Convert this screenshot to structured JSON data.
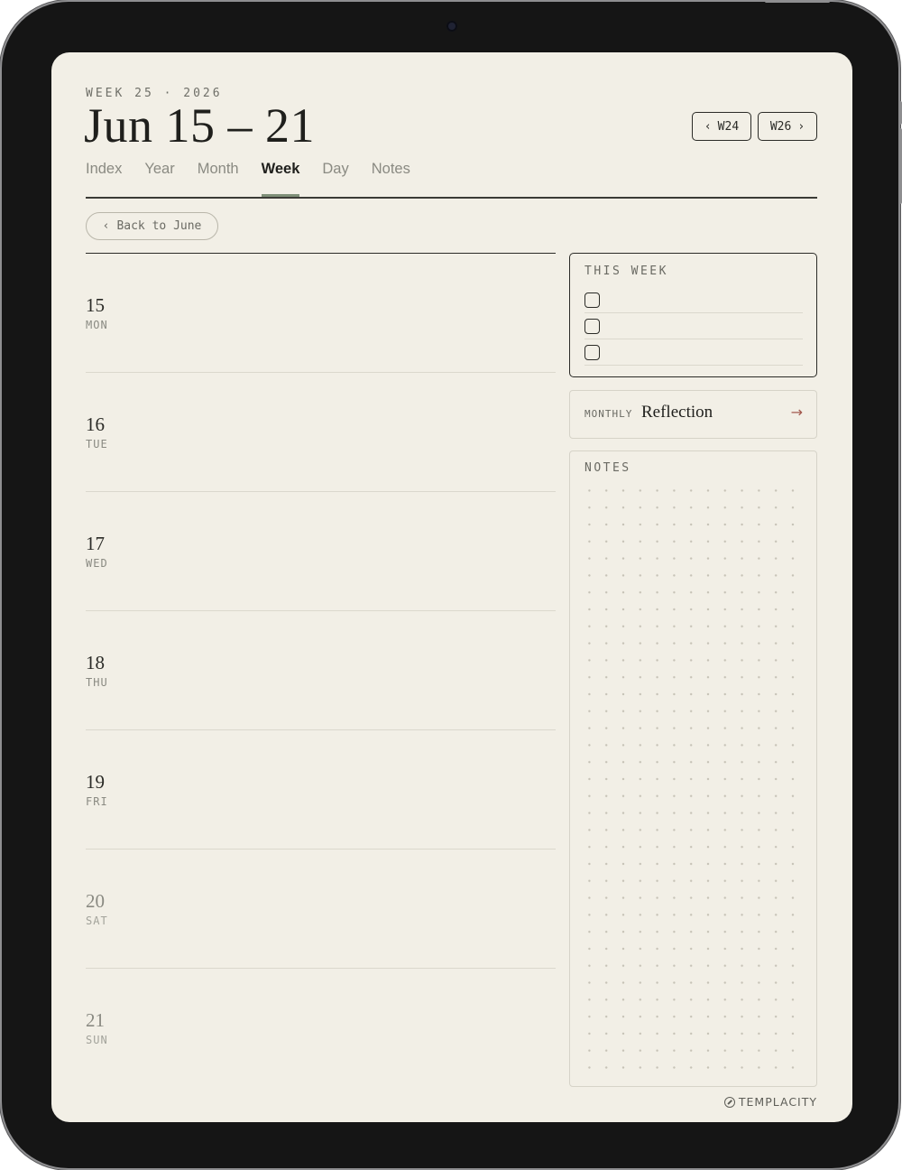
{
  "header": {
    "week_label": "WEEK 25 · 2026",
    "title": "Jun 15 – 21",
    "prev_week": "W24",
    "next_week": "W26",
    "prev_chevron": "‹",
    "next_chevron": "›"
  },
  "tabs": [
    {
      "label": "Index"
    },
    {
      "label": "Year"
    },
    {
      "label": "Month"
    },
    {
      "label": "Week",
      "active": true
    },
    {
      "label": "Day"
    },
    {
      "label": "Notes"
    }
  ],
  "back": {
    "chevron": "‹",
    "label": "Back to June"
  },
  "days": [
    {
      "num": "15",
      "name": "MON"
    },
    {
      "num": "16",
      "name": "TUE"
    },
    {
      "num": "17",
      "name": "WED"
    },
    {
      "num": "18",
      "name": "THU"
    },
    {
      "num": "19",
      "name": "FRI"
    },
    {
      "num": "20",
      "name": "SAT"
    },
    {
      "num": "21",
      "name": "SUN"
    }
  ],
  "this_week": {
    "heading": "THIS WEEK",
    "task_count_shown": 3
  },
  "reflection": {
    "small": "MONTHLY",
    "big": "Reflection",
    "arrow": "→"
  },
  "notes": {
    "heading": "NOTES"
  },
  "brand": {
    "name": "TEMPLACITY",
    "icon": "templacity-logo-icon"
  },
  "colors": {
    "paper": "#f2efe6",
    "ink": "#1f1f1c",
    "accent": "#7f8f78",
    "arrow": "#a35a4f"
  }
}
